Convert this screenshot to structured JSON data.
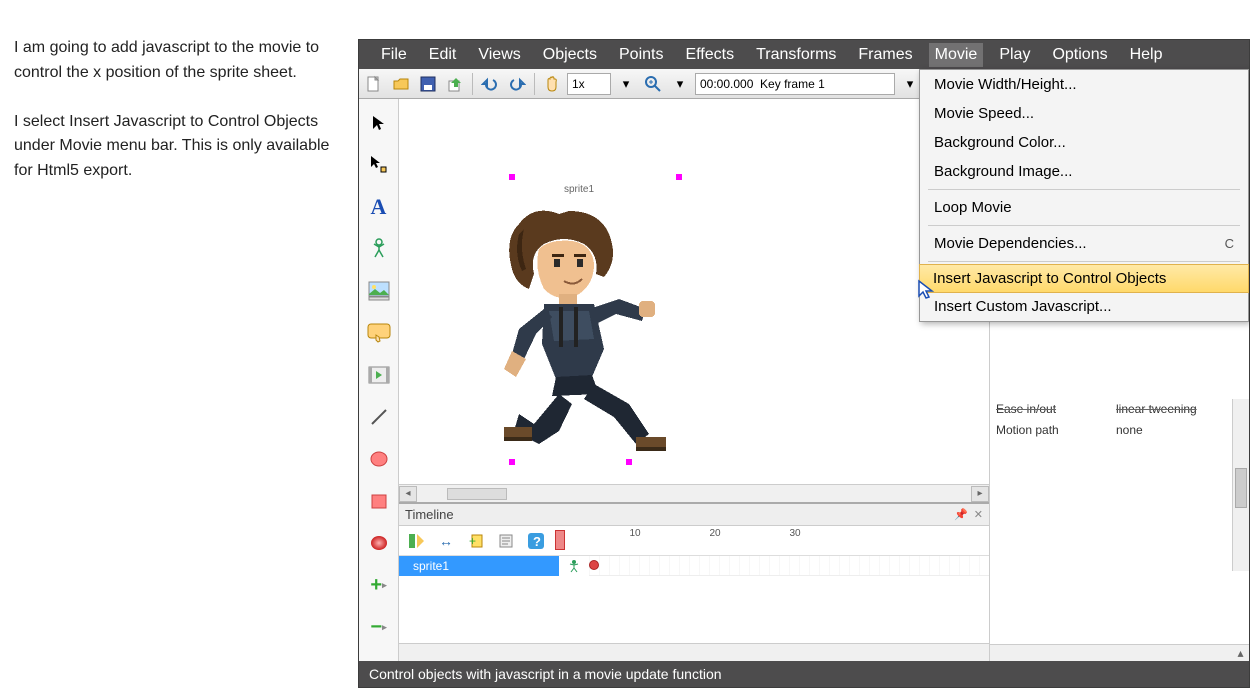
{
  "instruction": {
    "p1": "I am going to add javascript to the movie to control the x position of the sprite sheet.",
    "p2": "I select Insert Javascript to Control Objects under Movie menu bar. This is only available for Html5 export."
  },
  "menubar": {
    "file": "File",
    "edit": "Edit",
    "views": "Views",
    "objects": "Objects",
    "points": "Points",
    "effects": "Effects",
    "transforms": "Transforms",
    "frames": "Frames",
    "movie": "Movie",
    "play": "Play",
    "options": "Options",
    "help": "Help"
  },
  "toolbar": {
    "zoom": "1x",
    "time": "00:00.000",
    "frame": "Key frame 1"
  },
  "canvas": {
    "sprite_label": "sprite1"
  },
  "timeline": {
    "title": "Timeline",
    "track_name": "sprite1",
    "ticks": [
      "10",
      "20",
      "30"
    ]
  },
  "properties": {
    "rows": [
      {
        "k": "Ease in/out",
        "v": "linear tweening"
      },
      {
        "k": "Motion path",
        "v": "none"
      }
    ]
  },
  "movie_menu": {
    "items": [
      "Movie Width/Height...",
      "Movie Speed...",
      "Background Color...",
      "Background Image...",
      "Loop Movie",
      "Movie Dependencies...",
      "Insert Javascript to Control Objects",
      "Insert Custom Javascript..."
    ],
    "dependencies_shortcut": "C"
  },
  "statusbar": {
    "text": "Control objects with javascript in a movie update function"
  }
}
